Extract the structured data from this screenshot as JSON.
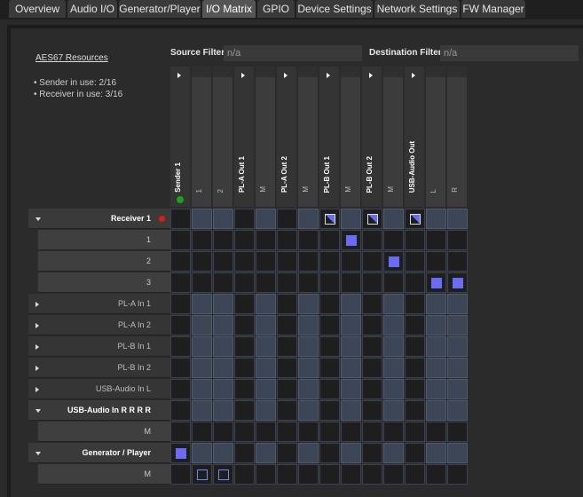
{
  "tabs": [
    {
      "label": "Overview",
      "active": false
    },
    {
      "label": "Audio I/O",
      "active": false
    },
    {
      "label": "Generator/Player",
      "active": false
    },
    {
      "label": "I/O Matrix",
      "active": true
    },
    {
      "label": "GPIO",
      "active": false
    },
    {
      "label": "Device Settings",
      "active": false
    },
    {
      "label": "Network Settings",
      "active": false
    },
    {
      "label": "FW Manager",
      "active": false
    }
  ],
  "resources": {
    "link": "AES67 Resources",
    "items": [
      "Sender in use: 2/16",
      "Receiver in use: 3/16"
    ]
  },
  "filters": {
    "source_label": "Source Filter",
    "source_value": "n/a",
    "dest_label": "Destination Filter",
    "dest_value": "n/a"
  },
  "columns": [
    {
      "label": "Sender 1",
      "group": true
    },
    {
      "label": "1",
      "group": false
    },
    {
      "label": "2",
      "group": false
    },
    {
      "label": "PL-A Out 1",
      "group": true
    },
    {
      "label": "M",
      "group": false
    },
    {
      "label": "PL-A Out 2",
      "group": true
    },
    {
      "label": "M",
      "group": false
    },
    {
      "label": "PL-B Out 1",
      "group": true
    },
    {
      "label": "M",
      "group": false
    },
    {
      "label": "PL-B Out 2",
      "group": true
    },
    {
      "label": "M",
      "group": false
    },
    {
      "label": "USB-Audio Out",
      "group": true
    },
    {
      "label": "L",
      "group": false
    },
    {
      "label": "R",
      "group": false
    }
  ],
  "rows": [
    {
      "label": "Receiver 1",
      "kind": "expanded"
    },
    {
      "label": "1",
      "kind": "child"
    },
    {
      "label": "2",
      "kind": "child"
    },
    {
      "label": "3",
      "kind": "child"
    },
    {
      "label": "PL-A In 1",
      "kind": "collapsed"
    },
    {
      "label": "PL-A In 2",
      "kind": "collapsed"
    },
    {
      "label": "PL-B In 1",
      "kind": "collapsed"
    },
    {
      "label": "PL-B In 2",
      "kind": "collapsed"
    },
    {
      "label": "USB-Audio In L",
      "kind": "collapsed"
    },
    {
      "label": "USB-Audio In R R R R",
      "kind": "expanded"
    },
    {
      "label": "M",
      "kind": "child"
    },
    {
      "label": "Generator / Player",
      "kind": "expanded"
    },
    {
      "label": "M",
      "kind": "child"
    }
  ],
  "routes": [
    {
      "row": 0,
      "col": 7,
      "type": "partial"
    },
    {
      "row": 0,
      "col": 9,
      "type": "partial"
    },
    {
      "row": 0,
      "col": 11,
      "type": "partial"
    },
    {
      "row": 1,
      "col": 8,
      "type": "full"
    },
    {
      "row": 2,
      "col": 10,
      "type": "full"
    },
    {
      "row": 3,
      "col": 12,
      "type": "full"
    },
    {
      "row": 3,
      "col": 13,
      "type": "full"
    },
    {
      "row": 11,
      "col": 0,
      "type": "full"
    },
    {
      "row": 12,
      "col": 1,
      "type": "hollow"
    },
    {
      "row": 12,
      "col": 2,
      "type": "hollow"
    }
  ],
  "colors": {
    "route": "#6b6cf5",
    "sender_status": "#1aa31a",
    "receiver_status": "#d81b1b"
  }
}
